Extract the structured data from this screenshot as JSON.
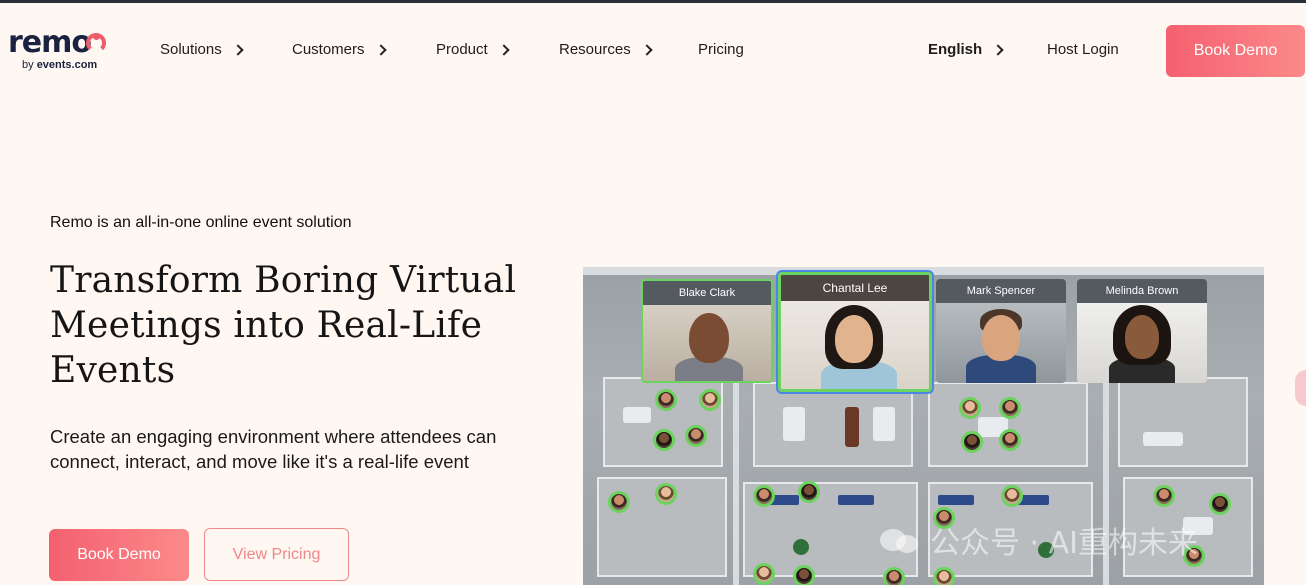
{
  "brand": {
    "logo_word": "remo",
    "logo_sub_prefix": "by ",
    "logo_sub_brand": "events.com"
  },
  "nav": {
    "items": [
      {
        "label": "Solutions",
        "has_chevron": true
      },
      {
        "label": "Customers",
        "has_chevron": true
      },
      {
        "label": "Product",
        "has_chevron": true
      },
      {
        "label": "Resources",
        "has_chevron": true
      },
      {
        "label": "Pricing",
        "has_chevron": false
      }
    ],
    "language": "English",
    "host_login": "Host Login",
    "cta": "Book Demo"
  },
  "hero": {
    "eyebrow": "Remo is an all-in-one online event solution",
    "headline": "Transform Boring Virtual Meetings into Real-Life Events",
    "subcopy": "Create an engaging environment where attendees can connect, interact, and move like it's a real-life event",
    "primary_cta": "Book Demo",
    "secondary_cta": "View Pricing"
  },
  "preview": {
    "video_tiles": [
      {
        "name": "Blake Clark"
      },
      {
        "name": "Chantal Lee"
      },
      {
        "name": "Mark Spencer"
      },
      {
        "name": "Melinda Brown"
      }
    ]
  },
  "watermark": {
    "text": "公众号 · AI重构未来"
  },
  "colors": {
    "background": "#fff7f2",
    "accent": "#f4606f",
    "accent_light": "#fb8a8a",
    "brand_dark": "#1b2140",
    "active_border": "#6dd35f"
  }
}
